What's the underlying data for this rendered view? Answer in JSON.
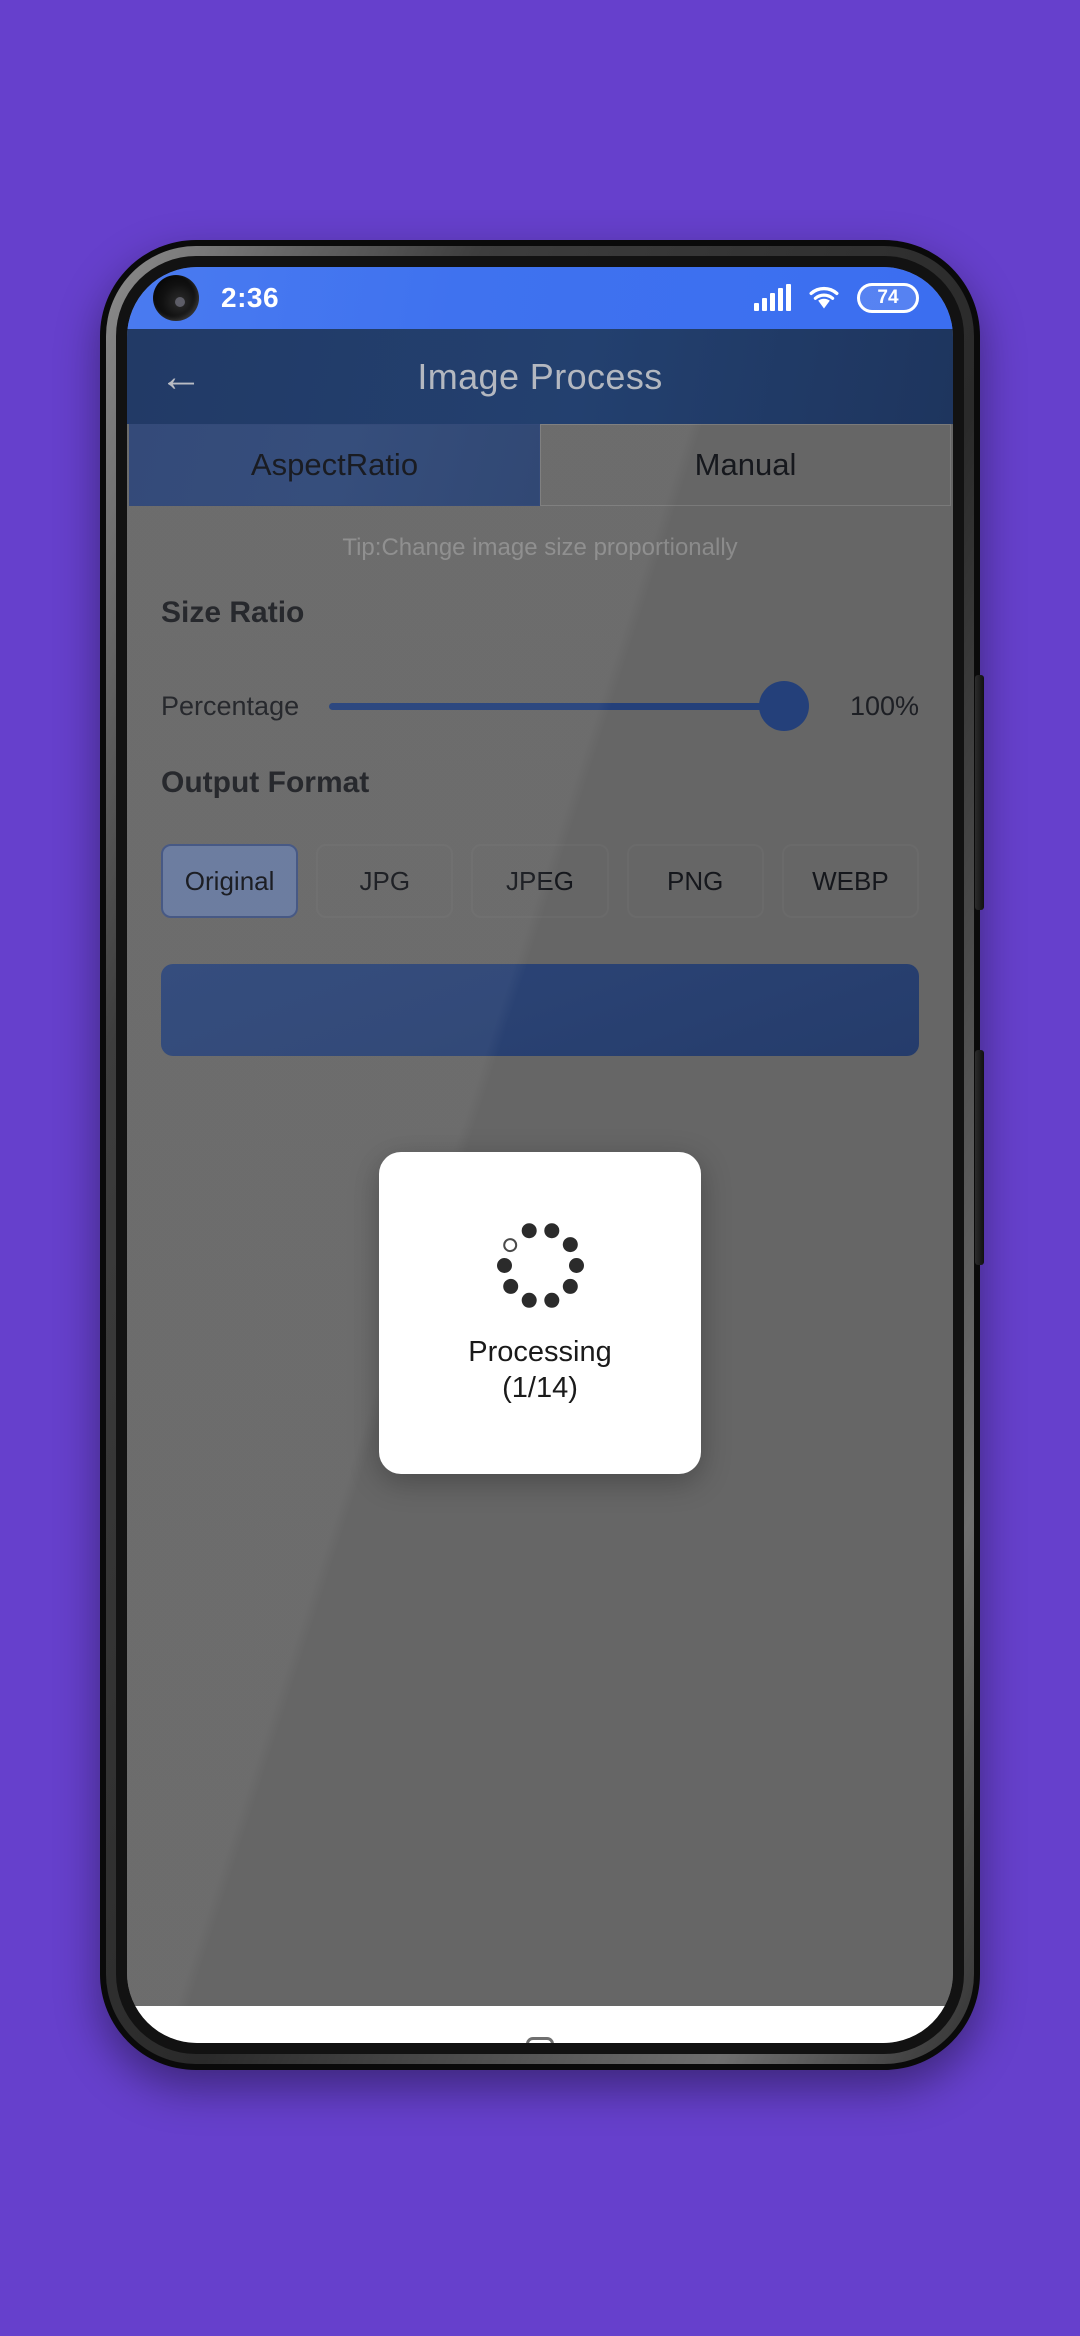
{
  "background": {
    "color": "#6640CC"
  },
  "device": {
    "frame_color": "#121212",
    "side_buttons": [
      "volume-rocker",
      "power-button"
    ]
  },
  "status_bar": {
    "time": "2:36",
    "background_color": "#3F72EF",
    "signal_icon": "cellular-signal-icon",
    "signal_bars": 5,
    "wifi_icon": "wifi-icon",
    "battery_icon": "battery-icon",
    "battery_level": "74"
  },
  "app_bar": {
    "back_icon": "back-arrow-icon",
    "back_glyph": "←",
    "title": "Image Process",
    "background_color": "#23406F",
    "title_color": "#B4B8C0"
  },
  "tabs": [
    {
      "label": "AspectRatio",
      "selected": true
    },
    {
      "label": "Manual",
      "selected": false
    }
  ],
  "main": {
    "tip": "Tip:Change image size proportionally",
    "size_ratio": {
      "title": "Size Ratio",
      "slider_label": "Percentage",
      "value": "100%",
      "percent": 100,
      "accent_color": "#24407A"
    },
    "output_format": {
      "title": "Output Format",
      "options": [
        {
          "label": "Original",
          "selected": true
        },
        {
          "label": "JPG",
          "selected": false
        },
        {
          "label": "JPEG",
          "selected": false
        },
        {
          "label": "PNG",
          "selected": false
        },
        {
          "label": "WEBP",
          "selected": false
        }
      ]
    },
    "action_button": {
      "label": "",
      "color": "#2A4273"
    },
    "scrim_color": "#666666"
  },
  "dialog": {
    "spinner_icon": "loading-spinner-icon",
    "spinner_dots": 10,
    "status_text": "Processing",
    "progress_text": "(1/14)",
    "background_color": "#FFFFFF"
  },
  "nav_bar": {
    "background_color": "#FFFFFF",
    "buttons": [
      {
        "icon": "nav-back-icon",
        "glyph": "‹"
      },
      {
        "icon": "nav-home-icon",
        "glyph": ""
      },
      {
        "icon": "nav-recents-icon",
        "glyph": ""
      }
    ]
  }
}
